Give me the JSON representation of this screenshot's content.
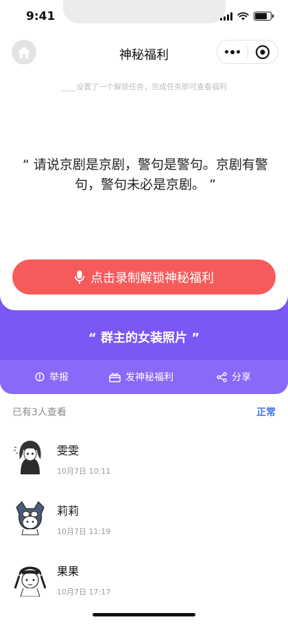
{
  "status_bar": {
    "time": "9:41"
  },
  "nav": {
    "title": "神秘福利"
  },
  "subtitle": "____设置了一个解锁任务，完成任务即可查看福利",
  "task_quote": "“ 请说京剧是京剧，警句是警句。京剧有警句，警句未必是京剧。 ”",
  "record_button_label": "点击录制解锁神秘福利",
  "gift_title": "“ 群主的女装照片 ”",
  "actions": {
    "report": "举报",
    "send_gift": "发神秘福利",
    "share": "分享"
  },
  "viewers": {
    "count_text": "已有3人查看",
    "sort_label": "正常",
    "items": [
      {
        "name": "雯雯",
        "time": "10月7日 10:11"
      },
      {
        "name": "莉莉",
        "time": "10月7日 11:19"
      },
      {
        "name": "果果",
        "time": "10月7日 17:17"
      }
    ]
  },
  "colors": {
    "record_button": "#f65b5b",
    "gift_panel": "#7b57f6",
    "sort_link": "#3d72e6"
  }
}
